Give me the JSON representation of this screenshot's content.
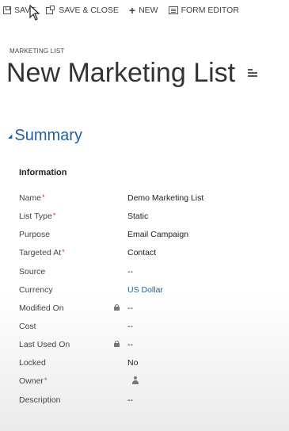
{
  "toolbar": {
    "save_label": "SAVE",
    "save_close_label": "SAVE & CLOSE",
    "new_label": "NEW",
    "form_editor_label": "FORM EDITOR"
  },
  "header": {
    "entity_label": "MARKETING LIST",
    "title": "New Marketing List"
  },
  "section": {
    "title": "Summary",
    "subtitle": "Information"
  },
  "fields": [
    {
      "label": "Name",
      "value": "Demo Marketing List",
      "required": "*"
    },
    {
      "label": "List Type",
      "value": "Static",
      "required": "*"
    },
    {
      "label": "Purpose",
      "value": "Email Campaign"
    },
    {
      "label": "Targeted At",
      "value": "Contact",
      "required": "*"
    },
    {
      "label": "Source",
      "value": "--"
    },
    {
      "label": "Currency",
      "value": "US Dollar"
    },
    {
      "label": "Modified On",
      "value": "--"
    },
    {
      "label": "Cost",
      "value": "--"
    },
    {
      "label": "Last Used On",
      "value": "--"
    },
    {
      "label": "Locked",
      "value": "No"
    },
    {
      "label": "Owner",
      "required": "*"
    },
    {
      "label": "Description",
      "value": "--"
    }
  ],
  "colors": {
    "accent": "#1f5f9e",
    "required": "#d63030"
  }
}
